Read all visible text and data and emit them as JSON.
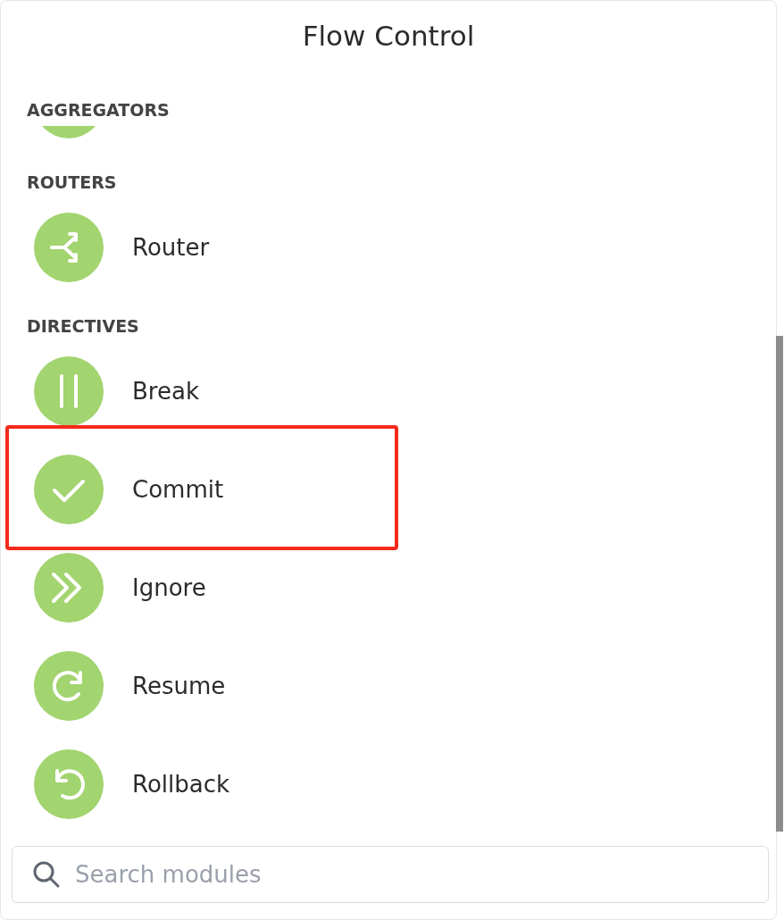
{
  "title": "Flow Control",
  "sections": [
    {
      "heading": "AGGREGATORS",
      "items": [
        {
          "kind": "clipped"
        }
      ]
    },
    {
      "heading": "ROUTERS",
      "items": [
        {
          "kind": "router",
          "label": "Router",
          "highlighted": false
        }
      ]
    },
    {
      "heading": "DIRECTIVES",
      "items": [
        {
          "kind": "pause",
          "label": "Break",
          "highlighted": false
        },
        {
          "kind": "check",
          "label": "Commit",
          "highlighted": true
        },
        {
          "kind": "skip",
          "label": "Ignore",
          "highlighted": false
        },
        {
          "kind": "redo",
          "label": "Resume",
          "highlighted": false
        },
        {
          "kind": "undo",
          "label": "Rollback",
          "highlighted": false
        }
      ]
    }
  ],
  "search": {
    "placeholder": "Search modules"
  }
}
